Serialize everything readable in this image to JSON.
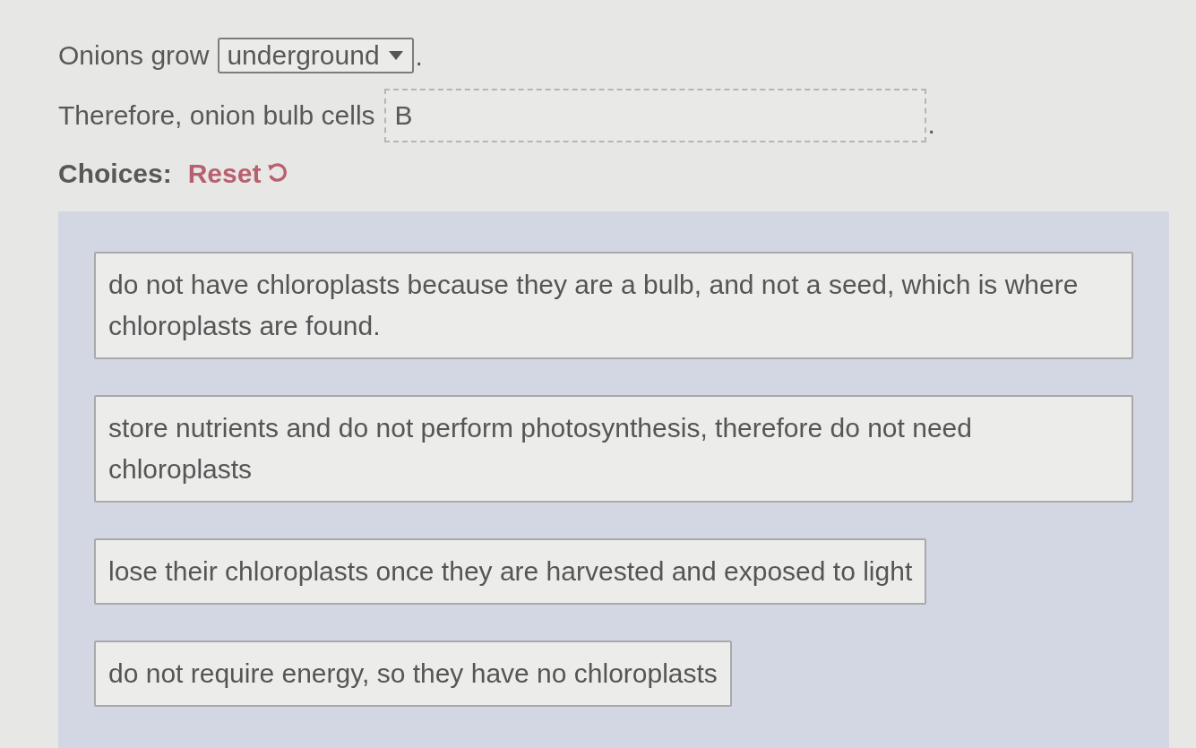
{
  "sentences": [
    {
      "kind": "dropdown",
      "before": "Onions grow",
      "value": "underground",
      "after": "."
    },
    {
      "kind": "blank",
      "before": "Therefore, onion bulb cells",
      "value": "B",
      "after": "."
    }
  ],
  "choices_label": "Choices:",
  "reset": {
    "label": "Reset"
  },
  "choices": [
    "do not have chloroplasts because they are a bulb, and not a seed, which is where chloroplasts are found.",
    "store nutrients and do not perform photosynthesis, therefore do not need chloroplasts",
    "lose their chloroplasts once they are harvested and exposed to light",
    "do not require energy, so they have no chloroplasts"
  ]
}
